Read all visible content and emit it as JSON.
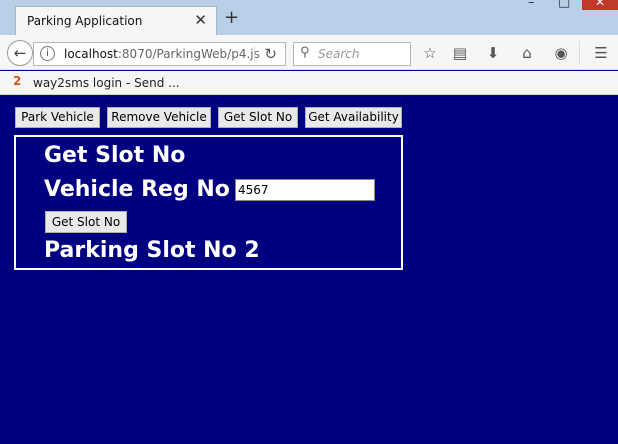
{
  "browser": {
    "tab_title": "Parking Application",
    "tab_close": "✕",
    "new_tab": "+",
    "win_min": "–",
    "win_max": "□",
    "win_close": "✕",
    "url_host": "localhost",
    "url_rest": ":8070/ParkingWeb/p4.js",
    "search_placeholder": "Search",
    "bookmark_label": "way2sms login - Send ...",
    "bookmark_icon": "2"
  },
  "nav_buttons": {
    "park": "Park Vehicle",
    "remove": "Remove Vehicle",
    "slot": "Get Slot No",
    "availability": "Get Availability"
  },
  "panel": {
    "heading": "Get Slot No",
    "reg_label": "Vehicle Reg No",
    "reg_value": "4567",
    "submit_label": "Get Slot No",
    "result_text": "Parking Slot No 2"
  },
  "colors": {
    "page_background": "#000080",
    "text": "#ffffff",
    "panel_border": "#ffffff"
  }
}
